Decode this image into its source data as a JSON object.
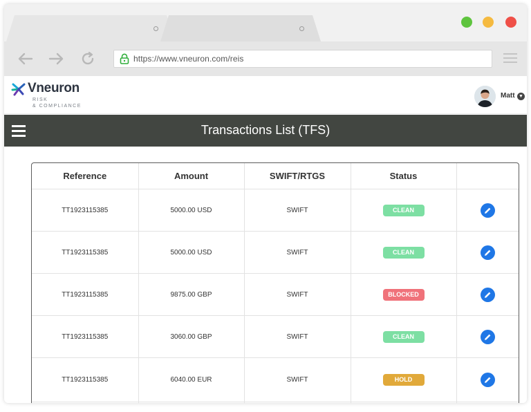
{
  "browser": {
    "url": "https://www.vneuron.com/reis"
  },
  "brand": {
    "name": "Vneuron",
    "tagline_line1": "RISK",
    "tagline_line2": "& COMPLIANCE"
  },
  "user": {
    "name": "Matt"
  },
  "header": {
    "title": "Transactions List (TFS)"
  },
  "table": {
    "columns": [
      "Reference",
      "Amount",
      "SWIFT/RTGS",
      "Status",
      ""
    ],
    "rows": [
      {
        "reference": "TT1923115385",
        "amount": "5000.00 USD",
        "channel": "SWIFT",
        "status": "CLEAN"
      },
      {
        "reference": "TT1923115385",
        "amount": "5000.00 USD",
        "channel": "SWIFT",
        "status": "CLEAN"
      },
      {
        "reference": "TT1923115385",
        "amount": "9875.00 GBP",
        "channel": "SWIFT",
        "status": "BLOCKED"
      },
      {
        "reference": "TT1923115385",
        "amount": "3060.00 GBP",
        "channel": "SWIFT",
        "status": "CLEAN"
      },
      {
        "reference": "TT1923115385",
        "amount": "6040.00 EUR",
        "channel": "SWIFT",
        "status": "HOLD"
      }
    ]
  },
  "status_colors": {
    "CLEAN": "#7ddfa3",
    "BLOCKED": "#f0727a",
    "HOLD": "#e1a93a"
  },
  "icons": {
    "back": "arrow-left-icon",
    "forward": "arrow-right-icon",
    "reload": "reload-icon",
    "lock": "lock-icon",
    "browser_menu": "hamburger-menu-icon",
    "nav_menu": "hamburger-menu-icon",
    "edit": "pencil-icon",
    "user_caret": "chevron-down-icon"
  },
  "colors": {
    "header_bg": "#424641",
    "edit_button": "#1f77e6"
  }
}
